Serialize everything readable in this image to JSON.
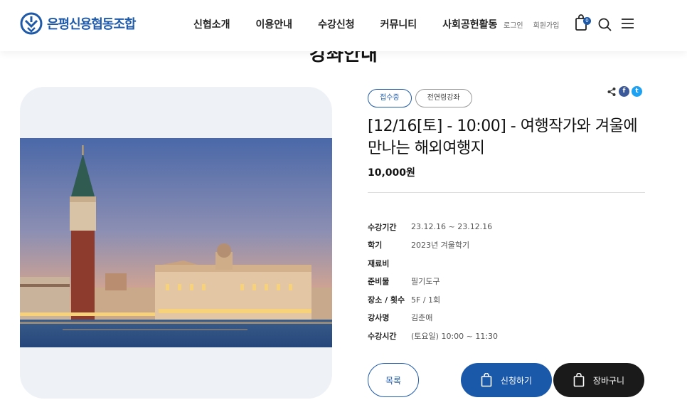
{
  "header": {
    "logo_text": "은평신용협동조합",
    "nav": [
      "신협소개",
      "이용안내",
      "수강신청",
      "커뮤니티",
      "사회공헌활동"
    ],
    "login": "로그인",
    "signup": "회원가입",
    "cart_count": "0"
  },
  "page": {
    "title": "강좌안내"
  },
  "course": {
    "status_tag": "접수중",
    "category_tag": "전연령강좌",
    "title": "[12/16[토] - 10:00] - 여행작가와 겨울에 만나는 해외여행지",
    "price": "10,000원",
    "info": [
      {
        "label": "수강기간",
        "value": "23.12.16 ~ 23.12.16"
      },
      {
        "label": "학기",
        "value": "2023년 겨울학기"
      },
      {
        "label": "재료비",
        "value": ""
      },
      {
        "label": "준비물",
        "value": "필기도구"
      },
      {
        "label": "장소 / 횟수",
        "value": "5F / 1회"
      },
      {
        "label": "강사명",
        "value": "김춘애"
      },
      {
        "label": "수강시간",
        "value": "(토요일) 10:00 ~ 11:30"
      }
    ]
  },
  "share": {
    "icons": [
      "share-icon",
      "facebook-icon",
      "twitter-icon"
    ],
    "facebook_glyph": "f",
    "twitter_glyph": "t"
  },
  "buttons": {
    "list": "목록",
    "apply": "신청하기",
    "cart": "장바구니"
  },
  "colors": {
    "brand": "#1f5aa8",
    "dark_button": "#1a1a1a",
    "image_card_bg": "#eef1f5"
  }
}
